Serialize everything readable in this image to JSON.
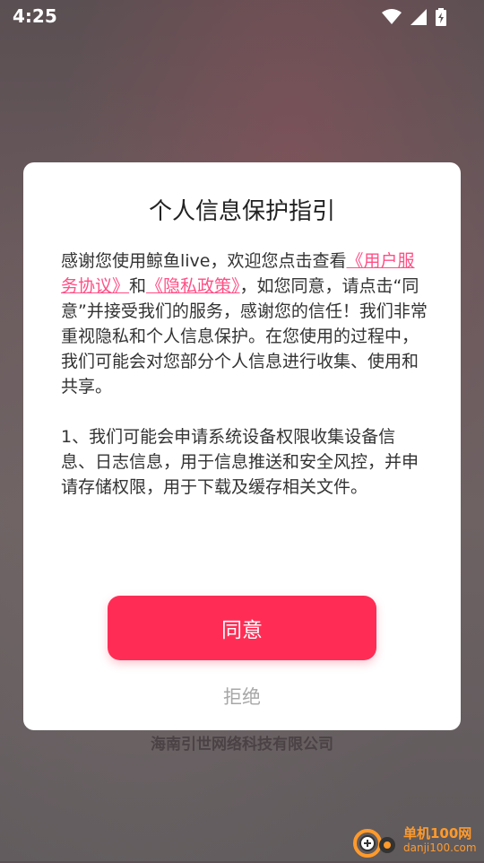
{
  "status_bar": {
    "time": "4:25",
    "icons": [
      "wifi-icon",
      "signal-icon",
      "battery-charging-icon"
    ]
  },
  "dialog": {
    "title": "个人信息保护指引",
    "intro_prefix": "感谢您使用鲸鱼live，欢迎您点击查看",
    "user_agreement_link": "《用户服务协议》",
    "and_text": "和",
    "privacy_policy_link": "《隐私政策》",
    "intro_suffix": "，如您同意，请点击“同意”并接受我们的服务，感谢您的信任！我们非常重视隐私和个人信息保护。在您使用的过程中，我们可能会对您部分个人信息进行收集、使用和共享。",
    "paragraph_2": "1、我们可能会申请系统设备权限收集设备信息、日志信息，用于信息推送和安全风控，并申请存储权限，用于下载及缓存相关文件。",
    "agree_label": "同意",
    "reject_label": "拒绝"
  },
  "background": {
    "company_name": "海南引世网络科技有限公司"
  },
  "watermark": {
    "line1": "单机100网",
    "line2": "danji100.com"
  },
  "colors": {
    "accent": "#ff2d55",
    "link": "#ff4f86"
  }
}
